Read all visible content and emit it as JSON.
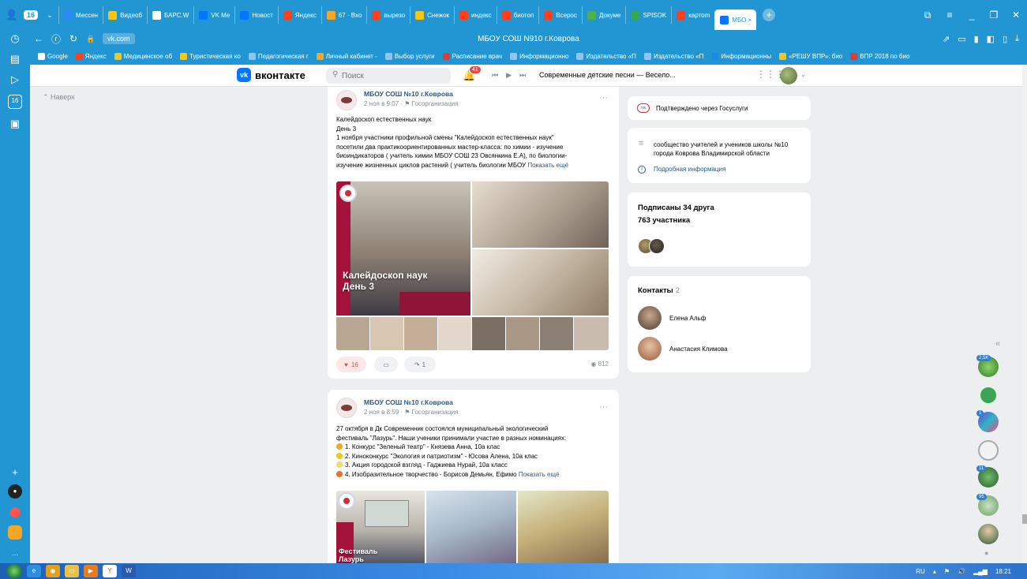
{
  "browser": {
    "tab_count": "16",
    "tabs": [
      {
        "label": "Мессен",
        "color": "#2b8af7"
      },
      {
        "label": "Видеоб",
        "color": "#f5c518"
      },
      {
        "label": "БАРС.W",
        "color": "#ffffff"
      },
      {
        "label": "VK Ме",
        "color": "#0077ff"
      },
      {
        "label": "Новост",
        "color": "#0077ff"
      },
      {
        "label": "Яндекс",
        "color": "#fc3f1d"
      },
      {
        "label": "67 · Вхо",
        "color": "#f5a623"
      },
      {
        "label": "вырезо",
        "color": "#fc3f1d"
      },
      {
        "label": "Снежок",
        "color": "#f5c518"
      },
      {
        "label": "индекс",
        "color": "#fc3f1d"
      },
      {
        "label": "биотоп",
        "color": "#fc3f1d"
      },
      {
        "label": "Всерос",
        "color": "#fc3f1d"
      },
      {
        "label": "Докуме",
        "color": "#4caf50"
      },
      {
        "label": "SPISOK",
        "color": "#34a853"
      },
      {
        "label": "картоm",
        "color": "#fc3f1d"
      }
    ],
    "active_tab": {
      "label": "МБО ×",
      "color": "#0077ff"
    },
    "url": "vk.com",
    "page_title": "МБОУ СОШ N910 г.Коврова",
    "bookmarks": [
      {
        "label": "Google",
        "color": "#ffffff"
      },
      {
        "label": "Яндекс",
        "color": "#fc3f1d"
      },
      {
        "label": "Медицинское об",
        "color": "#f5c518"
      },
      {
        "label": "Туристическая ко",
        "color": "#f5c518"
      },
      {
        "label": "Педагогическая г",
        "color": "#8fc4ef"
      },
      {
        "label": "Личный кабинет -",
        "color": "#f5a623"
      },
      {
        "label": "Выбор услуги",
        "color": "#8fc4ef"
      },
      {
        "label": "Расписание врач",
        "color": "#e53935"
      },
      {
        "label": "Информационно",
        "color": "#8fc4ef"
      },
      {
        "label": "Издательство «П",
        "color": "#8fc4ef"
      },
      {
        "label": "Издательство «П",
        "color": "#8fc4ef"
      },
      {
        "label": "Информационны",
        "color": "#1e88e5"
      },
      {
        "label": "«РЕШУ ВПР»: био",
        "color": "#f5c518"
      },
      {
        "label": "ВПР 2018 по био",
        "color": "#e53935"
      }
    ]
  },
  "vk": {
    "logo_text": "вконтакте",
    "search_placeholder": "Поиск",
    "notif_count": "41",
    "track": "Современные детские песни — Весело..."
  },
  "main": {
    "back_to_top": "Наверх",
    "posts": [
      {
        "author": "МБОУ СОШ №10 г.Коврова",
        "meta": "2 ноя в 9:07 · ⚑ Госорганизация",
        "lines": [
          "Калейдоскоп естественных наук",
          "День 3",
          "1 ноября участники профильной смены \"Калейдоскоп естественных наук\"",
          "посетили два практикоориентированных мастер-класса: по химии - изучение",
          "биоиндикаторов ( учитель химии МБОУ СОШ 23 Овсянкина Е.А), по биологии-",
          "изучение жизненных циклов растений ( учитель биологии МБОУ"
        ],
        "show_more": "Показать ещё",
        "photo_label_1": "Калейдоскоп наук",
        "photo_label_2": "День 3",
        "likes": "16",
        "shares": "1",
        "views": "812"
      },
      {
        "author": "МБОУ СОШ №10 г.Коврова",
        "meta": "2 ноя в 8:59 · ⚑ Госорганизация",
        "lines": [
          "27 октября в Дк Современник состоялся муниципальный экологический",
          "фестиваль \"Лазурь\". Наши ученики принимали участие в разных номинациях:",
          "1. Конкурс \"Зеленый театр\" - Князева Анна, 10а клас",
          "2. Киноконкурс \"Экология и патриотизм\" - Юсова Алена, 10а клас",
          "3. Акция городской взгляд - Гаджиева Нурай, 10а класс",
          "4. Изобразительное творчество - Борисов Демьян, Ефимо"
        ],
        "emoji_colors": [
          "#f5a623",
          "#f5c518",
          "#f7d774",
          "#e8732a"
        ],
        "show_more": "Показать ещё",
        "photo_label_1": "Фестиваль",
        "photo_label_2": "Лазурь"
      }
    ]
  },
  "sidebar": {
    "verified_text": "Подтверждено через Госуслуги",
    "description": "сообщество учителей и учеников школы №10 города Коврова Владимирской области",
    "details_link": "Подробная информация",
    "friends_subscribed": "Подписаны 34 друга",
    "members": "763 участника",
    "contacts_title": "Контакты",
    "contacts_count": "2",
    "contacts": [
      {
        "name": "Елена Альф"
      },
      {
        "name": "Анастасия Климова"
      }
    ]
  },
  "right_panel": {
    "badges": [
      "2,5K",
      "1",
      "11",
      "95"
    ]
  },
  "taskbar": {
    "lang": "RU",
    "time": "18:21"
  }
}
